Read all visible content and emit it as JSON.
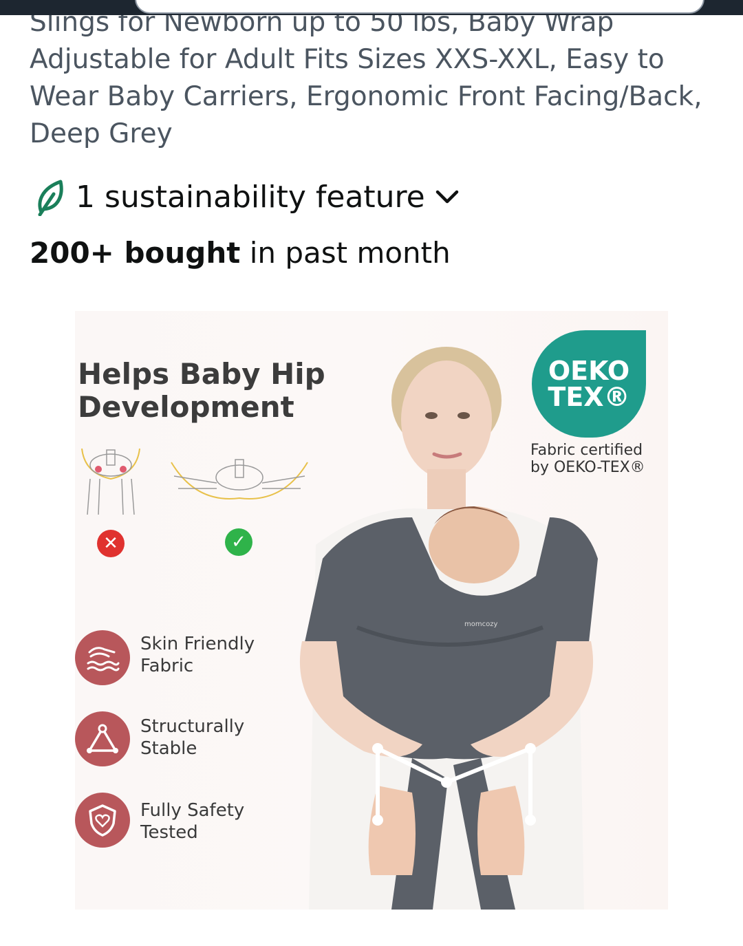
{
  "product": {
    "title": "Slings for Newborn up to 50 lbs, Baby Wrap Adjustable for Adult Fits Sizes XXS-XXL, Easy to Wear Baby Carriers, Ergonomic Front Facing/Back, Deep Grey",
    "sustainability": {
      "label": "1 sustainability feature",
      "icon": "leaf-icon",
      "chevron": "chevron-down-icon"
    },
    "purchase_stat": {
      "bold": "200+ bought",
      "rest": " in past month"
    }
  },
  "image": {
    "headline": "Helps Baby Hip Development",
    "certification": {
      "logo_line1": "OEKO",
      "logo_line2": "TEX®",
      "caption": "Fabric certified by OEKO-TEX®"
    },
    "wrap_brand": "momcozy",
    "comparison": [
      {
        "status": "wrong",
        "icon": "x-circle-icon",
        "color": "#e0322f"
      },
      {
        "status": "correct",
        "icon": "check-circle-icon",
        "color": "#2fb34a"
      }
    ],
    "features": [
      {
        "label": "Skin Friendly Fabric",
        "icon": "hand-wave-icon"
      },
      {
        "label": "Structurally Stable",
        "icon": "triangle-icon"
      },
      {
        "label": "Fully Safety Tested",
        "icon": "shield-heart-icon"
      }
    ]
  },
  "colors": {
    "accent_feature": "#b8575b",
    "oeko_teal": "#1f9c8c",
    "sustainability_green": "#1a7f5a",
    "topbar": "#1d2630"
  }
}
